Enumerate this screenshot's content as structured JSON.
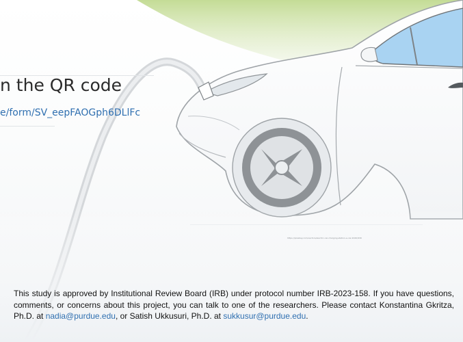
{
  "slide": {
    "heading": "n the QR code",
    "survey_link": "e/form/SV_eepFAOGph6DLlFc",
    "image_credit": "https://pixabay.com/vectors/electric-car-charging-station-e-car-2020/930",
    "notice": {
      "part1": "This study is approved by Institutional Review Board (IRB) under protocol number IRB-2023-158. If you have questions, comments, or concerns about this project, you can talk to one of the researchers. Please contact Konstantina Gkritza, Ph.D. at ",
      "email1": "nadia@purdue.edu",
      "part2": ", or Satish Ukkusuri, Ph.D. at ",
      "email2": "sukkusur@purdue.edu",
      "part3": "."
    }
  },
  "colors": {
    "link": "#2f6fb0",
    "hill_green": "#c9dfa0",
    "car_window": "#a9d3f2",
    "tire": "#8e9296"
  },
  "icons": {
    "illustration": "electric-car-charging-illustration"
  }
}
